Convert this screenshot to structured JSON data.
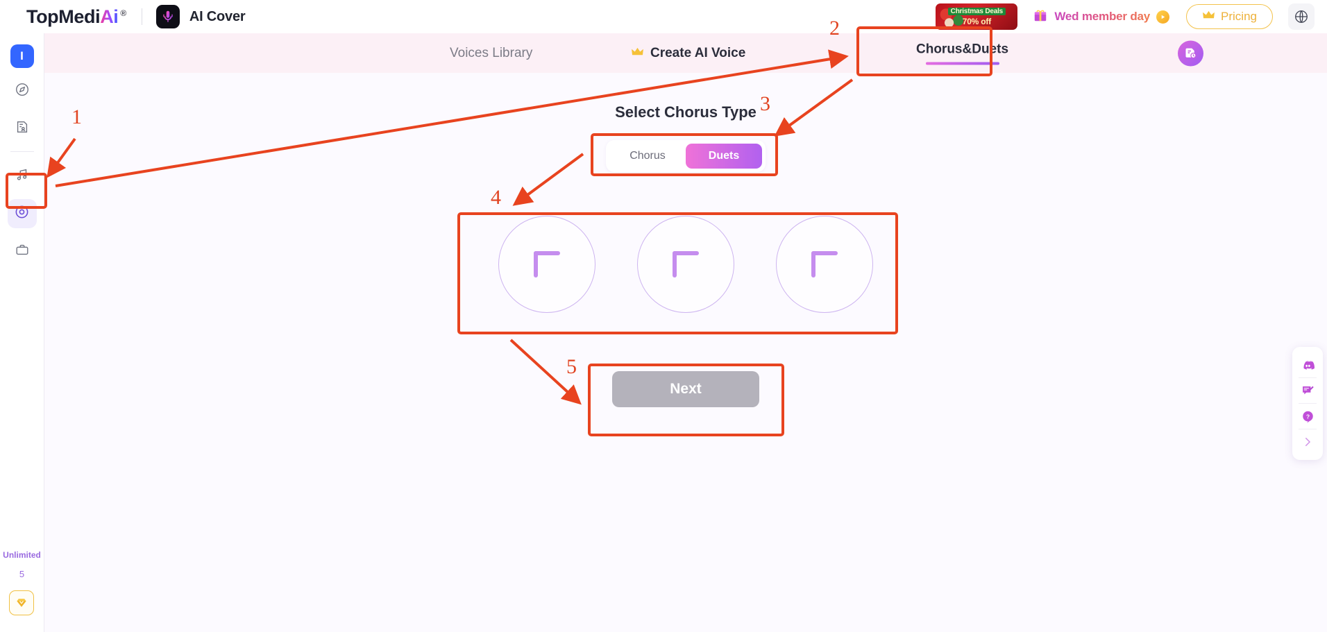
{
  "brand": {
    "name_main": "TopMedi",
    "name_accent": "Ai",
    "registered": "®",
    "app_title": "AI Cover",
    "app_icon": "microphone-icon"
  },
  "topbar": {
    "promo_banner": {
      "line1": "Christmas Deals",
      "line2": "70% off",
      "icon": "christmas-promo-banner"
    },
    "member_day": {
      "label": "Wed member day",
      "gift_icon": "gift-icon",
      "play_icon": "play-icon"
    },
    "pricing": {
      "label": "Pricing",
      "icon": "crown-icon"
    },
    "language": {
      "icon": "globe-icon"
    }
  },
  "sidebar": {
    "avatar": "I",
    "items": [
      {
        "name": "explore-icon"
      },
      {
        "name": "document-person-icon"
      },
      {
        "name": "music-note-icon"
      },
      {
        "name": "vinyl-disc-icon",
        "active": true
      },
      {
        "name": "briefcase-icon"
      }
    ],
    "footer": {
      "plan_label": "Unlimited",
      "credits": "5",
      "gem_icon": "gem-icon"
    }
  },
  "nav": {
    "tabs": [
      {
        "label": "Voices Library",
        "active": false,
        "icon": null
      },
      {
        "label": "Create AI Voice",
        "active": false,
        "icon": "crown-icon"
      },
      {
        "label": "Chorus&Duets",
        "active": true,
        "icon": null
      }
    ],
    "history_button": {
      "icon": "history-document-icon"
    }
  },
  "main": {
    "title": "Select Chorus Type",
    "toggle": {
      "options": [
        "Chorus",
        "Duets"
      ],
      "selected": "Duets"
    },
    "slots": [
      {
        "icon": "plus-icon"
      },
      {
        "icon": "plus-icon"
      },
      {
        "icon": "plus-icon"
      }
    ],
    "next_button": {
      "label": "Next",
      "disabled": true
    }
  },
  "right_dock": {
    "items": [
      {
        "name": "discord-icon"
      },
      {
        "name": "feedback-icon"
      },
      {
        "name": "help-question-icon"
      },
      {
        "name": "collapse-chevron-icon"
      }
    ]
  },
  "annotations": {
    "accent_color": "#e8431f",
    "steps": [
      {
        "number": "1",
        "target": "sidebar-item-chorus-duets"
      },
      {
        "number": "2",
        "target": "nav-tab-chorus-duets"
      },
      {
        "number": "3",
        "target": "chorus-type-toggle"
      },
      {
        "number": "4",
        "target": "voice-slots-group"
      },
      {
        "number": "5",
        "target": "next-button"
      }
    ]
  }
}
